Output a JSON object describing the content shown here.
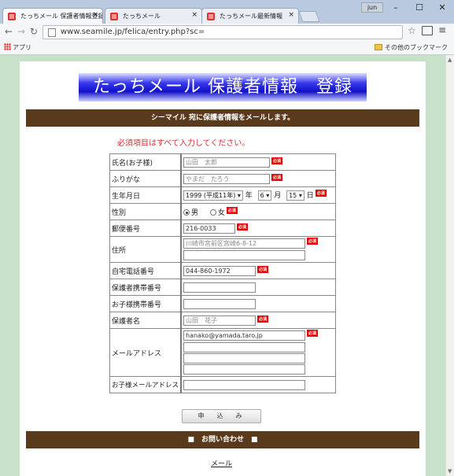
{
  "browser": {
    "tabs": [
      {
        "label": "たっちメール 保護者情報登録"
      },
      {
        "label": "たっちメール"
      },
      {
        "label": "たっちメール最新情報"
      }
    ],
    "user": "jun",
    "url": "www.seamile.jp/felica/entry.php?sc=",
    "apps_label": "アプリ",
    "other_bookmarks": "その他のブックマーク"
  },
  "page": {
    "banner": "たっちメール 保護者情報　登録",
    "subtitle": "シーマイル 宛に保護者情報をメールします。",
    "required_note": "必須項目はすべて入力してください。",
    "required_badge": "必須",
    "fields": {
      "child_name": {
        "label": "氏名(お子様)",
        "value": "山田　太郎"
      },
      "furigana": {
        "label": "ふりがな",
        "value": "やまだ　たろう"
      },
      "birthdate": {
        "label": "生年月日",
        "year": "1999 (平成11年)",
        "year_suffix": "年",
        "month": "6",
        "month_suffix": "月",
        "day": "15",
        "day_suffix": "日"
      },
      "gender": {
        "label": "性別",
        "male": "男",
        "female": "女",
        "selected": "male"
      },
      "postal": {
        "label": "郵便番号",
        "value": "216-0033"
      },
      "address": {
        "label": "住所",
        "value1": "川崎市宮前区宮崎6-8-12",
        "value2": ""
      },
      "home_phone": {
        "label": "自宅電話番号",
        "value": "044-860-1972"
      },
      "guardian_mobile": {
        "label": "保護者携帯番号",
        "value": ""
      },
      "child_mobile": {
        "label": "お子様携帯番号",
        "value": ""
      },
      "guardian_name": {
        "label": "保護者名",
        "value": "山田　花子"
      },
      "email": {
        "label": "メールアドレス",
        "value1": "hanako@yamada.taro.jp",
        "value2": "",
        "value3": "",
        "value4": ""
      },
      "child_email": {
        "label": "お子様メールアドレス",
        "value": ""
      }
    },
    "submit": "申　込　み",
    "contact_bar": "■　お問い合わせ　■",
    "mail_link": "メール"
  }
}
